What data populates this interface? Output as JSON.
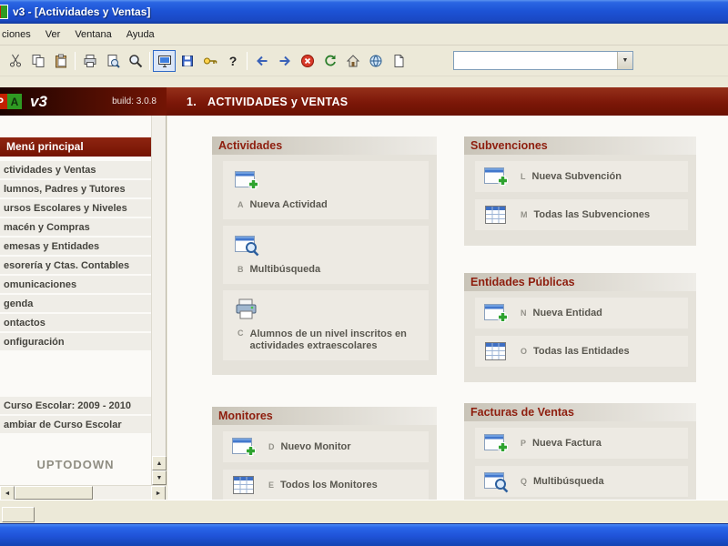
{
  "window": {
    "title": "v3 - [Actividades y Ventas]"
  },
  "menu": {
    "items": [
      "ciones",
      "Ver",
      "Ventana",
      "Ayuda"
    ]
  },
  "toolbar": {
    "buttons": [
      "cut",
      "copy",
      "paste",
      "print",
      "print-preview",
      "search",
      "monitor-view",
      "save",
      "key",
      "help",
      "back",
      "forward",
      "stop",
      "refresh",
      "home",
      "web",
      "document"
    ],
    "combo_value": ""
  },
  "header": {
    "logo_letters": {
      "p": "P",
      "a": "A"
    },
    "brand": "v3",
    "build": "build: 3.0.8",
    "section_number": "1.",
    "section_title": "ACTIVIDADES y VENTAS"
  },
  "sidebar": {
    "title": "Menú principal",
    "items": [
      "ctividades y Ventas",
      "lumnos, Padres y Tutores",
      "ursos Escolares y Niveles",
      "macén y Compras",
      "emesas y Entidades",
      "esorería y Ctas. Contables",
      "omunicaciones",
      "genda",
      "ontactos",
      "onfiguración"
    ],
    "course": "Curso Escolar: 2009 - 2010",
    "change_course": "ambiar de Curso Escolar",
    "watermark": "UPTODOWN"
  },
  "sections": {
    "actividades": {
      "title": "Actividades",
      "items": [
        {
          "key": "A",
          "label": "Nueva Actividad",
          "icon": "window-plus-icon"
        },
        {
          "key": "B",
          "label": "Multibúsqueda",
          "icon": "window-search-icon"
        },
        {
          "key": "C",
          "label": "Alumnos de un nivel inscritos en actividades extraescolares",
          "icon": "printer-icon"
        }
      ]
    },
    "monitores": {
      "title": "Monitores",
      "items": [
        {
          "key": "D",
          "label": "Nuevo Monitor",
          "icon": "window-plus-icon"
        },
        {
          "key": "E",
          "label": "Todos los Monitores",
          "icon": "table-icon"
        }
      ]
    },
    "subvenciones": {
      "title": "Subvenciones",
      "items": [
        {
          "key": "L",
          "label": "Nueva Subvención",
          "icon": "window-plus-icon"
        },
        {
          "key": "M",
          "label": "Todas las Subvenciones",
          "icon": "table-icon"
        }
      ]
    },
    "entidades": {
      "title": "Entidades Públicas",
      "items": [
        {
          "key": "N",
          "label": "Nueva Entidad",
          "icon": "window-plus-icon"
        },
        {
          "key": "O",
          "label": "Todas las Entidades",
          "icon": "table-icon"
        }
      ]
    },
    "facturas": {
      "title": "Facturas de Ventas",
      "items": [
        {
          "key": "P",
          "label": "Nueva Factura",
          "icon": "window-plus-icon"
        },
        {
          "key": "Q",
          "label": "Multibúsqueda",
          "icon": "window-search-icon"
        }
      ]
    }
  },
  "colors": {
    "maroon": "#7c1708",
    "chrome": "#ece9d8",
    "panel": "#e5e2da",
    "titlebar_blue": "#1d53d6",
    "item_bg": "#edeae3"
  }
}
